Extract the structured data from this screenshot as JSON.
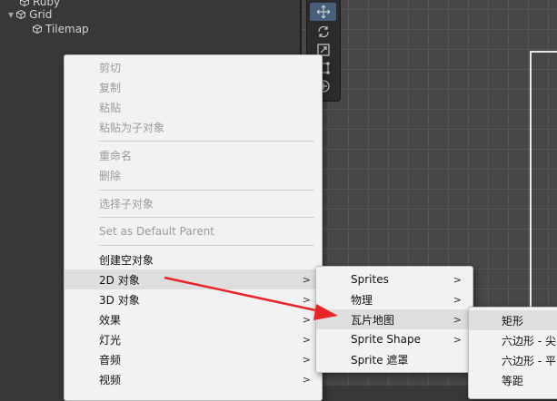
{
  "hierarchy": {
    "items": [
      {
        "label": "Ruby"
      },
      {
        "label": "Grid"
      },
      {
        "label": "Tilemap"
      }
    ]
  },
  "context_menu": {
    "items": [
      {
        "label": "剪切",
        "enabled": false
      },
      {
        "label": "复制",
        "enabled": false
      },
      {
        "label": "粘贴",
        "enabled": false
      },
      {
        "label": "粘贴为子对象",
        "enabled": false
      },
      {
        "label": "重命名",
        "enabled": false
      },
      {
        "label": "删除",
        "enabled": false
      },
      {
        "label": "选择子对象",
        "enabled": false
      },
      {
        "label": "Set as Default Parent",
        "enabled": false
      },
      {
        "label": "创建空对象",
        "enabled": true
      },
      {
        "label": "2D 对象",
        "enabled": true,
        "submenu": true,
        "highlighted": true
      },
      {
        "label": "3D 对象",
        "enabled": true,
        "submenu": true
      },
      {
        "label": "效果",
        "enabled": true,
        "submenu": true
      },
      {
        "label": "灯光",
        "enabled": true,
        "submenu": true
      },
      {
        "label": "音频",
        "enabled": true,
        "submenu": true
      },
      {
        "label": "视频",
        "enabled": true,
        "submenu": true
      }
    ]
  },
  "submenu_2d": {
    "items": [
      {
        "label": "Sprites",
        "submenu": true
      },
      {
        "label": "物理",
        "submenu": true
      },
      {
        "label": "瓦片地图",
        "submenu": true,
        "highlighted": true
      },
      {
        "label": "Sprite Shape",
        "submenu": true
      },
      {
        "label": "Sprite 遮罩",
        "submenu": false
      }
    ]
  },
  "submenu_tilemap": {
    "items": [
      {
        "label": "矩形",
        "highlighted": true
      },
      {
        "label": "六边形 - 尖"
      },
      {
        "label": "六边形 - 平"
      },
      {
        "label": "等距"
      }
    ]
  },
  "icons": {
    "submenu_arrow": "chevron-right-icon",
    "tools": [
      "move-tool-icon",
      "rotate-tool-icon",
      "scale-tool-icon",
      "rect-tool-icon",
      "transform-tool-icon"
    ]
  },
  "colors": {
    "annotation_arrow": "#e8262a",
    "menu_background": "#f2f2f2",
    "highlight": "#dedede"
  }
}
